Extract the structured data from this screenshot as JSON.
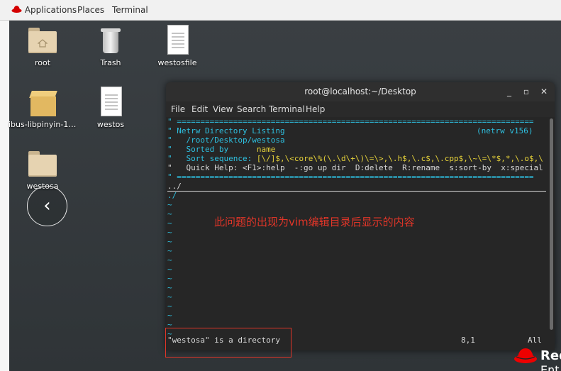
{
  "topbar": {
    "applications": "Applications",
    "places": "Places",
    "terminal": "Terminal"
  },
  "desktop": {
    "icons": [
      {
        "label": "root"
      },
      {
        "label": "Trash"
      },
      {
        "label": "westosfile"
      },
      {
        "label": "ibus-libpinyin-1...."
      },
      {
        "label": "westos"
      },
      {
        "label": "westosa"
      }
    ]
  },
  "window": {
    "title": "root@localhost:~/Desktop",
    "controls": {
      "minimize": "_",
      "maximize": "▫",
      "close": "✕"
    },
    "menu": [
      "File",
      "Edit",
      "View",
      "Search",
      "Terminal",
      "Help"
    ]
  },
  "terminal": {
    "sep": "\" ============================================================================",
    "header": "\" Netrw Directory Listing",
    "version": "(netrw v156)",
    "path": "\"   /root/Desktop/westosa",
    "sorted_prefix": "\"   Sorted by      ",
    "sorted_val": "name",
    "sortseq_prefix": "\"   Sort sequence: ",
    "sortseq_val": "[\\/]$,\\<core\\%(\\.\\d\\+\\)\\=\\>,\\.h$,\\.c$,\\.cpp$,\\~\\=\\*$,*,\\.o$,\\",
    "quickhelp": "\"   Quick Help: <F1>:help  -:go up dir  D:delete  R:rename  s:sort-by  x:special",
    "entry1": "../",
    "entry2": "./",
    "tilde": "~",
    "status_msg": "\"westosa\" is a directory",
    "position": "8,1",
    "all": "All"
  },
  "annotation": "此问题的出现为vim编辑目录后显示的内容",
  "logo": {
    "text": "Red",
    "text2": "Ent"
  },
  "colors": {
    "annotation": "#e03528",
    "vim_comment": "#2ec0e0",
    "vim_keyword": "#e6d23a",
    "logo_red": "#ee0000"
  }
}
